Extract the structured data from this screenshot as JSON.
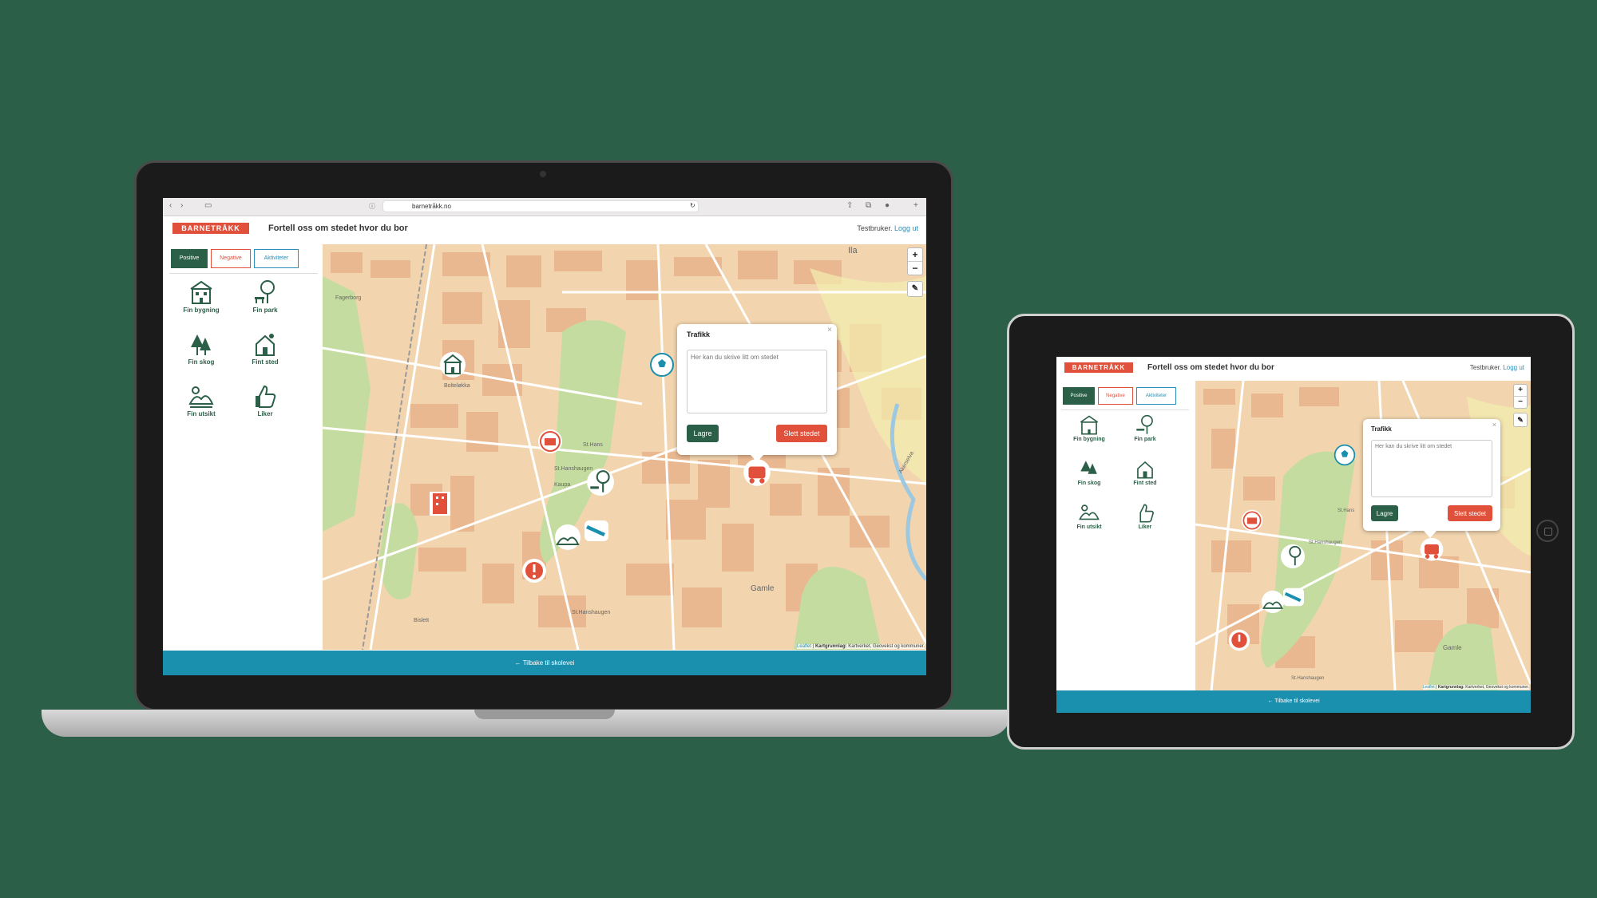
{
  "app": {
    "url": "barnetråkk.no",
    "logo": "BARNETRÅKK",
    "title": "Fortell oss om stedet hvor du bor",
    "user_name": "Testbruker.",
    "logout": "Logg ut",
    "tabs": [
      "Positive",
      "Negative",
      "Aktiviteter"
    ],
    "categories": [
      "Fin bygning",
      "Fin park",
      "Fin skog",
      "Fint sted",
      "Fin utsikt",
      "Liker"
    ],
    "popup": {
      "title": "Trafikk",
      "close": "×",
      "placeholder": "Her kan du skrive litt om stedet",
      "save": "Lagre",
      "delete": "Slett stedet"
    },
    "footer": "← Tilbake til skolevei",
    "attribution_link": "Leaflet",
    "attribution_sep": " | ",
    "attribution_bold": "Kartgrunnlag:",
    "attribution_text": " Kartverket, Geovekst og kommuner.",
    "zoom_in": "+",
    "zoom_out": "−",
    "draw_tool": "✎",
    "place_labels": [
      "Ila",
      "Fagerborg",
      "Bolteløkka",
      "St.Hans",
      "St.Hanshaugen",
      "Kaupa",
      "Gamle",
      "Bislett",
      "St.Hanshaugen",
      "Akerselva"
    ]
  },
  "colors": {
    "background": "#2c5f48",
    "brand_green": "#2c5f48",
    "brand_red": "#e0503a",
    "brand_blue": "#1a8fae",
    "map_base": "#f2d5ae",
    "map_park": "#c5dca0"
  }
}
